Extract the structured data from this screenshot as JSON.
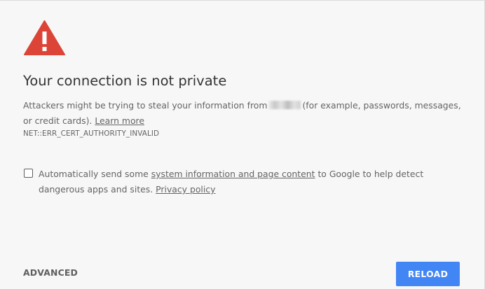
{
  "interstitial": {
    "title": "Your connection is not private",
    "explanation_before": "Attackers might be trying to steal your information from",
    "explanation_after": "(for example, passwords, messages, or credit cards).",
    "learn_more": "Learn more",
    "error_code": "NET::ERR_CERT_AUTHORITY_INVALID"
  },
  "optin": {
    "checked": false,
    "text_before": "Automatically send some",
    "link_label": "system information and page content",
    "text_after": "to Google to help detect dangerous apps and sites.",
    "privacy_link": "Privacy policy"
  },
  "actions": {
    "advanced_label": "ADVANCED",
    "reload_label": "RELOAD"
  },
  "colors": {
    "warning_icon": "#db4437",
    "reload_button": "#4285f4",
    "background": "#f7f7f7"
  },
  "icons": {
    "warning": "warning-triangle-icon"
  }
}
